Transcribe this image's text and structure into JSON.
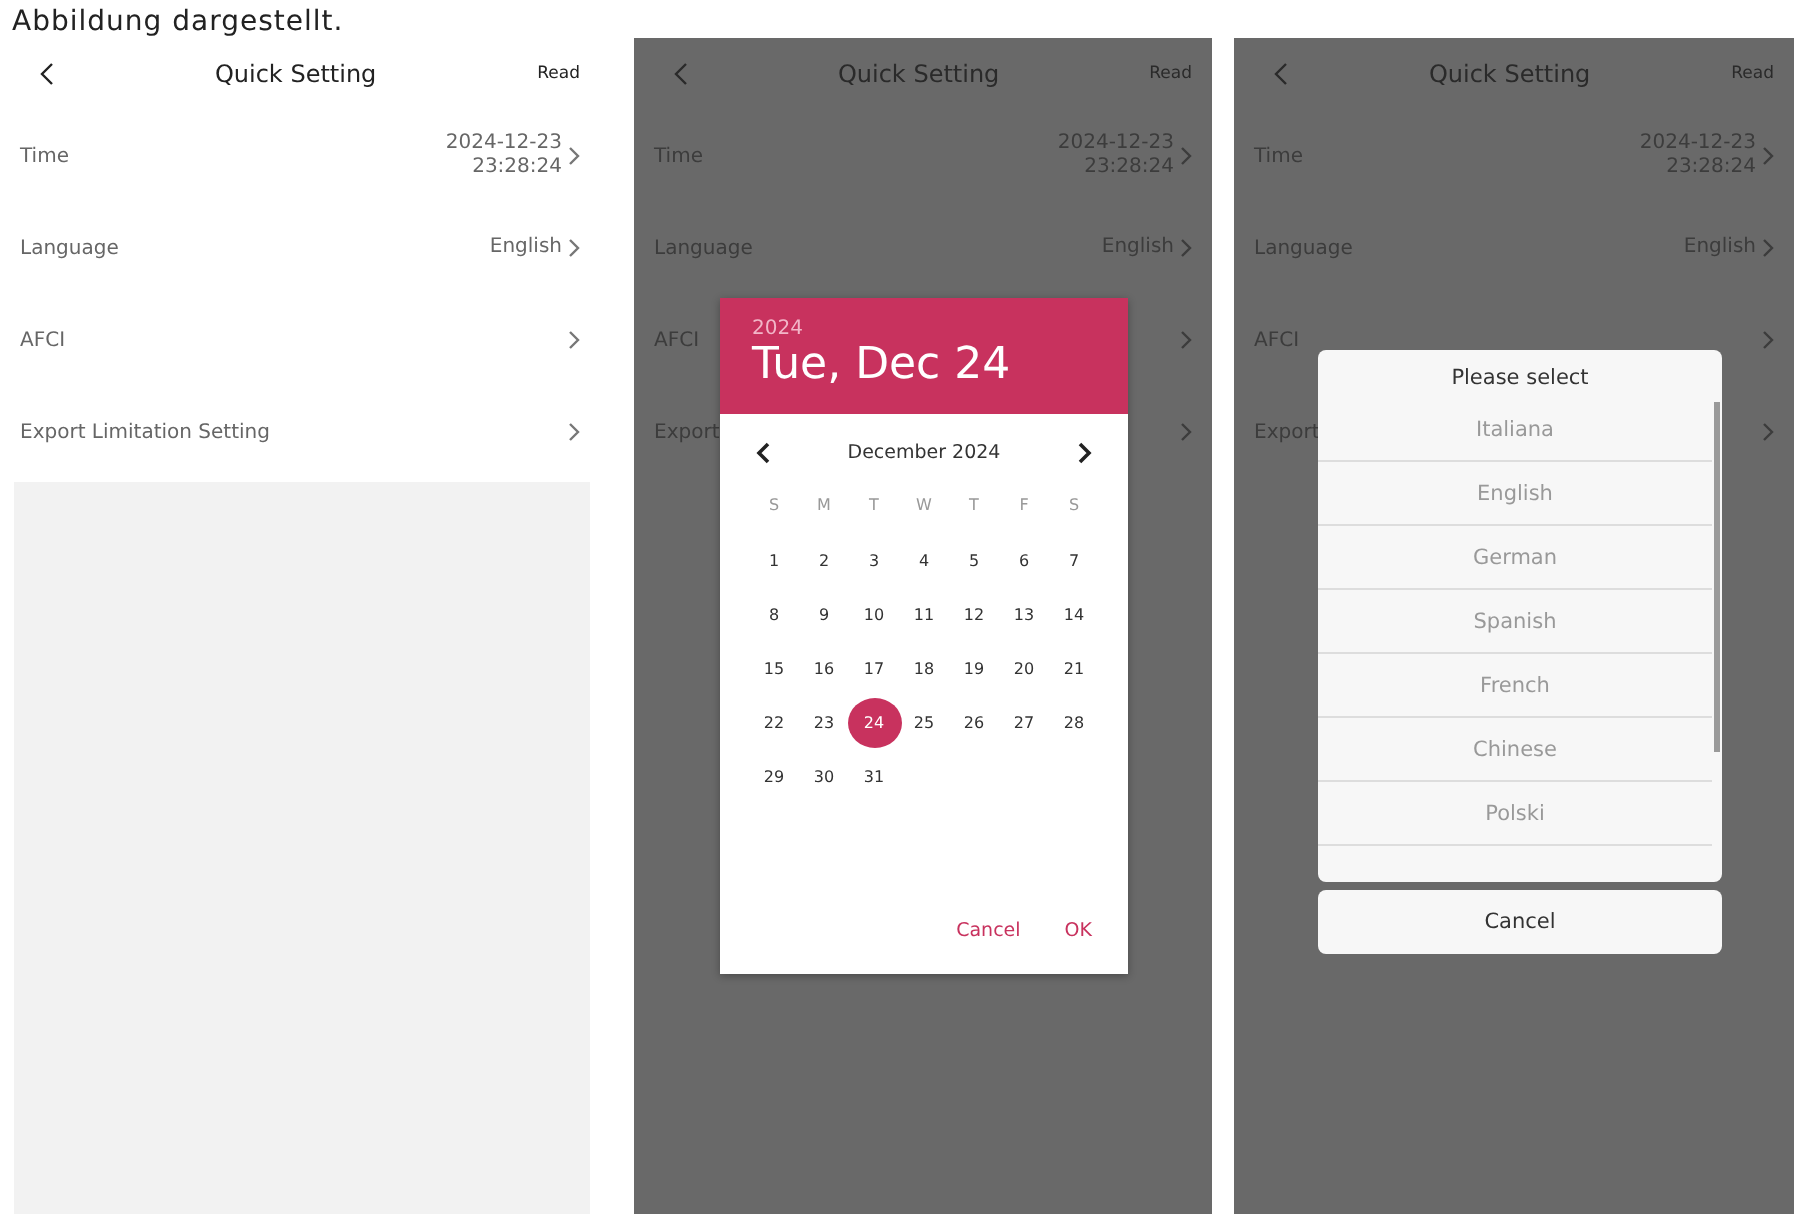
{
  "caption": "Abbildung dargestellt.",
  "screens": [
    {
      "dimmed": false,
      "title": "Quick Setting",
      "action": "Read",
      "rows": [
        {
          "label": "Time",
          "value": "2024-12-23\n23:28:24"
        },
        {
          "label": "Language",
          "value": "English"
        },
        {
          "label": "AFCI"
        },
        {
          "label": "Export Limitation Setting"
        }
      ]
    },
    {
      "dimmed": true,
      "title": "Quick Setting",
      "action": "Read",
      "rows": [
        {
          "label": "Time",
          "value": "2024-12-23\n23:28:24"
        },
        {
          "label": "Language",
          "value": "English"
        },
        {
          "label": "AFCI"
        },
        {
          "label": "Export"
        }
      ],
      "dialog": {
        "kind": "date_picker",
        "year": "2024",
        "date": "Tue, Dec 24",
        "month": "December 2024",
        "weekdays": [
          "S",
          "M",
          "T",
          "W",
          "T",
          "F",
          "S"
        ],
        "days": [
          {
            "label": "1",
            "selected": false
          },
          {
            "label": "2",
            "selected": false
          },
          {
            "label": "3",
            "selected": false
          },
          {
            "label": "4",
            "selected": false
          },
          {
            "label": "5",
            "selected": false
          },
          {
            "label": "6",
            "selected": false
          },
          {
            "label": "7",
            "selected": false
          },
          {
            "label": "8",
            "selected": false
          },
          {
            "label": "9",
            "selected": false
          },
          {
            "label": "10",
            "selected": false
          },
          {
            "label": "11",
            "selected": false
          },
          {
            "label": "12",
            "selected": false
          },
          {
            "label": "13",
            "selected": false
          },
          {
            "label": "14",
            "selected": false
          },
          {
            "label": "15",
            "selected": false
          },
          {
            "label": "16",
            "selected": false
          },
          {
            "label": "17",
            "selected": false
          },
          {
            "label": "18",
            "selected": false
          },
          {
            "label": "19",
            "selected": false
          },
          {
            "label": "20",
            "selected": false
          },
          {
            "label": "21",
            "selected": false
          },
          {
            "label": "22",
            "selected": false
          },
          {
            "label": "23",
            "selected": false
          },
          {
            "label": "24",
            "selected": true
          },
          {
            "label": "25",
            "selected": false
          },
          {
            "label": "26",
            "selected": false
          },
          {
            "label": "27",
            "selected": false
          },
          {
            "label": "28",
            "selected": false
          },
          {
            "label": "29",
            "selected": false
          },
          {
            "label": "30",
            "selected": false
          },
          {
            "label": "31",
            "selected": false
          }
        ],
        "buttons": [
          "Cancel",
          "OK"
        ]
      }
    },
    {
      "dimmed": true,
      "title": "Quick Setting",
      "action": "Read",
      "rows": [
        {
          "label": "Time",
          "value": "2024-12-23\n23:28:24"
        },
        {
          "label": "Language",
          "value": "English"
        },
        {
          "label": "AFCI"
        },
        {
          "label": "Export"
        }
      ],
      "dialog": {
        "kind": "language_picker",
        "title": "Please select",
        "options": [
          "Italiana",
          "English",
          "German",
          "Spanish",
          "French",
          "Chinese",
          "Polski"
        ],
        "cancel": "Cancel"
      }
    }
  ]
}
